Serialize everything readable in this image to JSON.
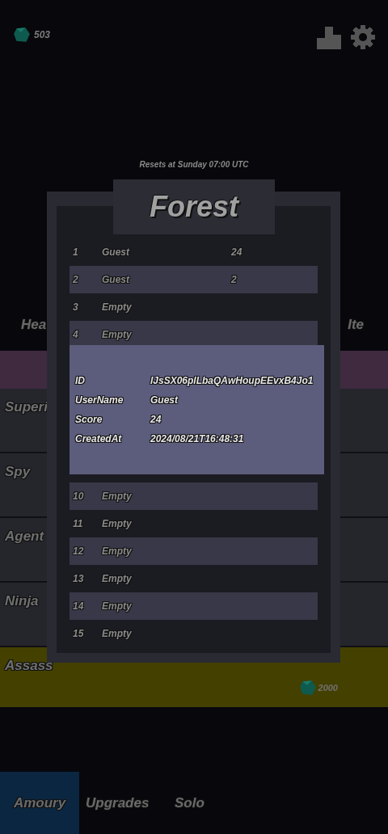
{
  "currency": {
    "amount": "503"
  },
  "reset_note": "Resets at Sunday 07:00 UTC",
  "background": {
    "headings": [
      "Hea",
      "Ite"
    ],
    "rows": [
      {
        "label": "Superi",
        "selected": false
      },
      {
        "label": "Spy",
        "selected": false
      },
      {
        "label": "Agent",
        "selected": false
      },
      {
        "label": "Ninja",
        "selected": false
      },
      {
        "label": "Assass",
        "selected": true,
        "price": "2000"
      }
    ]
  },
  "leaderboard": {
    "title": "Forest",
    "rows": [
      {
        "rank": "1",
        "name": "Guest",
        "score": "24"
      },
      {
        "rank": "2",
        "name": "Guest",
        "score": "2"
      },
      {
        "rank": "3",
        "name": "Empty"
      },
      {
        "rank": "4",
        "name": "Empty"
      },
      {
        "rank": "10",
        "name": "Empty"
      },
      {
        "rank": "11",
        "name": "Empty"
      },
      {
        "rank": "12",
        "name": "Empty"
      },
      {
        "rank": "13",
        "name": "Empty"
      },
      {
        "rank": "14",
        "name": "Empty"
      },
      {
        "rank": "15",
        "name": "Empty"
      }
    ],
    "details": [
      {
        "label": "ID",
        "value": "lJsSX06plLbaQAwHoupEEvxB4Jo1"
      },
      {
        "label": "UserName",
        "value": "Guest"
      },
      {
        "label": "Score",
        "value": "24"
      },
      {
        "label": "CreatedAt",
        "value": "2024/08/21T16:48:31"
      }
    ]
  },
  "tabs": [
    {
      "label": "Amoury",
      "selected": true
    },
    {
      "label": "Upgrades",
      "selected": false
    },
    {
      "label": "Solo",
      "selected": false
    }
  ]
}
